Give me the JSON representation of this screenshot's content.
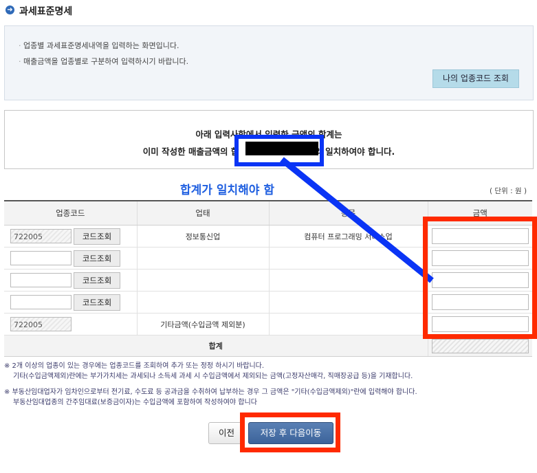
{
  "header": {
    "icon": "arrow-right-circle-icon",
    "title": "과세표준명세"
  },
  "info": {
    "bullets": [
      "업종별 과세표준명세내역을 입력하는 화면입니다.",
      "매출금액을 업종별로 구분하여 입력하시기 바랍니다."
    ],
    "lookup_button": "나의 업종코드 조회"
  },
  "notice": {
    "line1": "아래 입력사항에서  입력한 금액의 합계는",
    "line2_pre": "이미 작성한 매출금액의 합",
    "line2_post": "와 일치하여야 합니다."
  },
  "annotation": {
    "text": "합계가 일치해야 함",
    "color": "#1f5fe0"
  },
  "unit": "( 단위 : 원 )",
  "table": {
    "headers": [
      "업종코드",
      "업태",
      "종목",
      "금액"
    ],
    "lookup_label": "코드조회",
    "rows": [
      {
        "code": "722005",
        "type": "정보통신업",
        "item": "컴퓨터 프로그래밍 서비스업",
        "amount": ""
      },
      {
        "code": "",
        "type": "",
        "item": "",
        "amount": ""
      },
      {
        "code": "",
        "type": "",
        "item": "",
        "amount": ""
      },
      {
        "code": "",
        "type": "",
        "item": "",
        "amount": ""
      }
    ],
    "other_row": {
      "code": "722005",
      "type": "기타금액(수입금액 제외분)",
      "amount": ""
    },
    "total_label": "합계"
  },
  "notes": [
    [
      "※ 2개 이상의 업종이 있는 경우에는 업종코드를 조회하여 추가 또는 정정 하시기 바랍니다.",
      "기타(수입금액제외)란에는 부가가치세는 과세되나 소득세 과세 시 수입금액에서 제외되는 금액(고정자산매각, 직매장공급 등)을 기재합니다."
    ],
    [
      "※ 부동산임대업자가 임차인으로부터 전기료, 수도료 등 공과금을 수취하여 납부하는 경우 그 금액은 \"기타(수입금액제외)\"란에 입력해야 합니다.",
      "부동산임대업종의 간주임대료(보증금이자)는 수입금액에 포함하여 작성하여야 합니다"
    ]
  ],
  "buttons": {
    "prev": "이전",
    "save_next": "저장 후 다음이동"
  },
  "colors": {
    "highlight_red": "#ff2a00",
    "highlight_blue": "#0a34f5",
    "primary_button": "#3c639a"
  }
}
